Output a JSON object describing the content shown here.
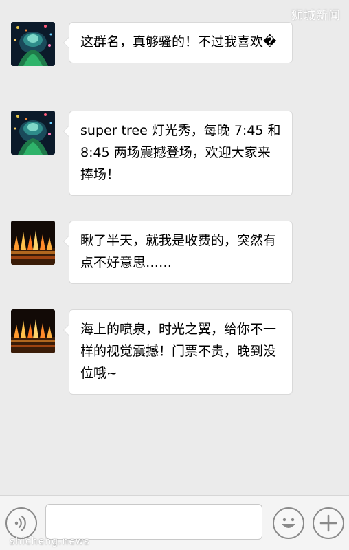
{
  "watermark": {
    "top": "狮城新闻",
    "bottom": "shicheng.news"
  },
  "messages": [
    {
      "avatar": "supertree-avatar",
      "text": "这群名，真够骚的！不过我喜欢�"
    },
    {
      "avatar": "supertree-avatar",
      "text": "super tree 灯光秀，每晚 7:45 和 8:45 两场震撼登场，欢迎大家来捧场！"
    },
    {
      "avatar": "fountain-avatar",
      "text": "瞅了半天，就我是收费的，突然有点不好意思……"
    },
    {
      "avatar": "fountain-avatar",
      "text": "海上的喷泉，时光之翼，给你不一样的视觉震撼！门票不贵，晚到没位哦~"
    }
  ],
  "toolbar": {
    "input_value": ""
  },
  "colors": {
    "background": "#ebebeb",
    "bubble": "#ffffff",
    "toolbar": "#f4f4f4",
    "icon_stroke": "#8a8a8a"
  }
}
